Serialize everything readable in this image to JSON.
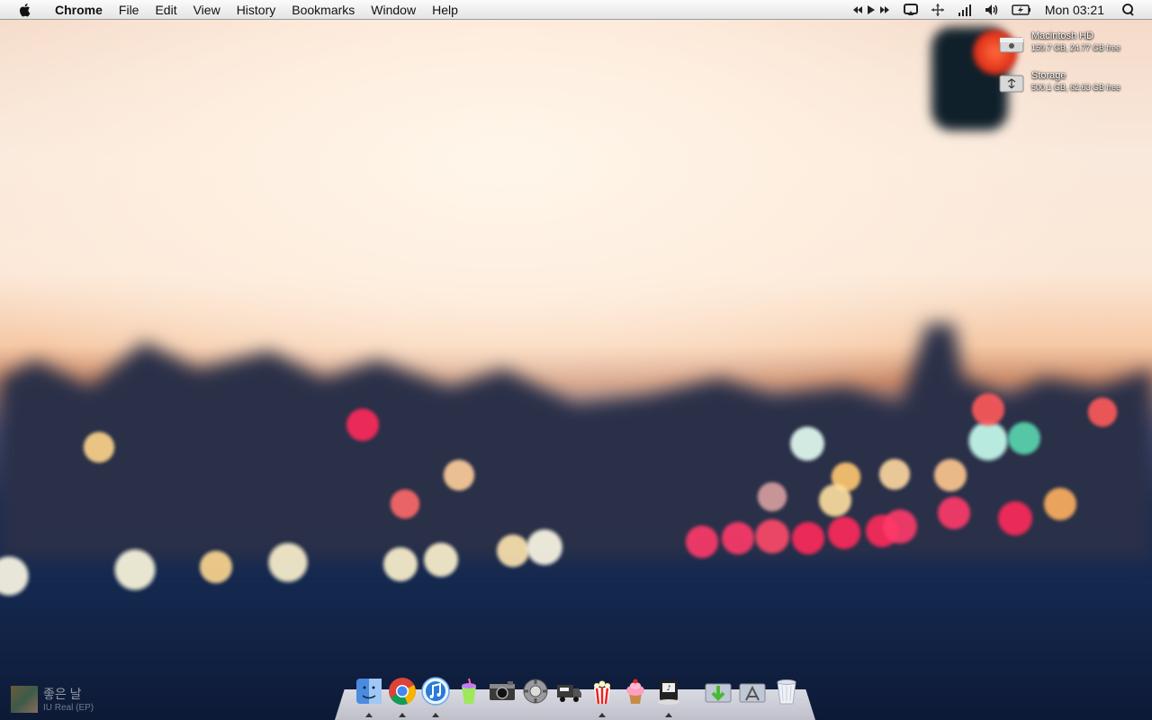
{
  "menubar": {
    "app_name": "Chrome",
    "items": [
      "File",
      "Edit",
      "View",
      "History",
      "Bookmarks",
      "Window",
      "Help"
    ],
    "clock": "Mon 03:21"
  },
  "status_icons": [
    "media-controls-icon",
    "airplay-icon",
    "network-icon",
    "signal-bars-icon",
    "volume-icon",
    "battery-icon",
    "spotlight-icon"
  ],
  "desktop": {
    "volumes": [
      {
        "name": "Macintosh HD",
        "info": "159.7 GB, 24.77 GB free",
        "icon": "harddrive-icon"
      },
      {
        "name": "Storage",
        "info": "500.1 GB, 62.63 GB free",
        "icon": "usb-drive-icon"
      }
    ]
  },
  "dock": {
    "apps": [
      "finder-icon",
      "chrome-icon",
      "itunes-icon",
      "slushie-icon",
      "camera-icon",
      "system-preferences-icon",
      "truck-icon",
      "popcorn-icon",
      "cupcake-icon",
      "ipod-icon",
      "downloads-stack-icon",
      "applications-stack-icon",
      "trash-icon"
    ]
  },
  "now_playing": {
    "title": "좋은 날",
    "artist": "IU Real (EP)"
  },
  "colors": {
    "menubar_bg": "#ececec",
    "bokeh_red": "#ff2a5a",
    "bokeh_orange": "#ffb86a",
    "bokeh_teal": "#7af2d0"
  }
}
